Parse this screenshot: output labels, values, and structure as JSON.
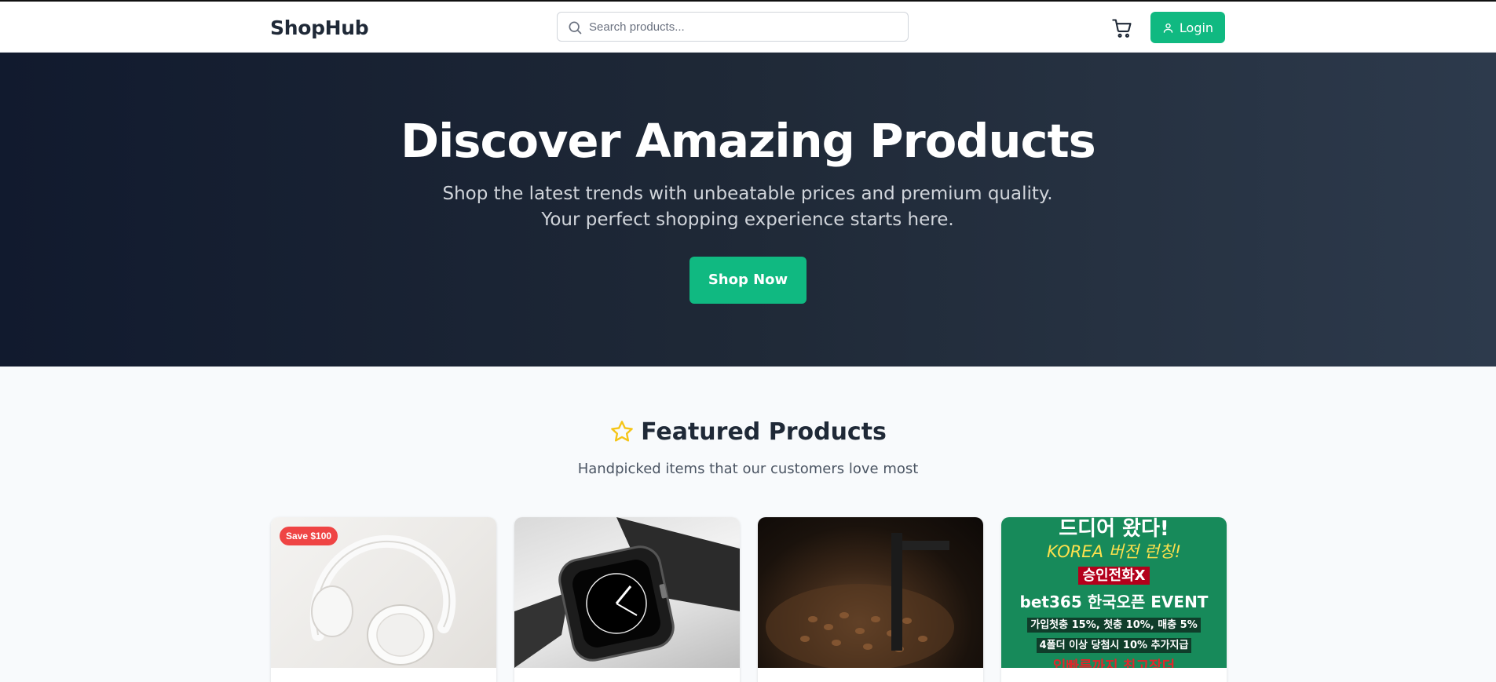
{
  "header": {
    "logo": "ShopHub",
    "search_placeholder": "Search products...",
    "login_label": "Login"
  },
  "hero": {
    "title": "Discover Amazing Products",
    "subtitle": "Shop the latest trends with unbeatable prices and premium quality. Your perfect shopping experience starts here.",
    "cta": "Shop Now"
  },
  "featured": {
    "title": "Featured Products",
    "subtitle": "Handpicked items that our customers love most",
    "products": [
      {
        "image": "white headphones",
        "badge": "Save $100"
      },
      {
        "image": "smartwatch"
      },
      {
        "image": "coffee beans roaster"
      },
      {
        "image": "advertisement banner",
        "ad_lines": [
          "드디어 왔다!",
          "KOREA 버전 런칭!",
          "승인전화X",
          "bet365 한국오픈 EVENT",
          "가입첫충 15%, 첫충 10%, 매충 5%",
          "4폴더 이상 당첨시 10% 추가지급",
          "입빠른까지 최고장더"
        ]
      }
    ]
  },
  "colors": {
    "brand_green": "#10b981",
    "hero_dark": "#1f2937",
    "badge_red": "#ef4444",
    "star_yellow": "#f5c518"
  },
  "icons": [
    "search-icon",
    "cart-icon",
    "user-icon",
    "star-icon"
  ]
}
